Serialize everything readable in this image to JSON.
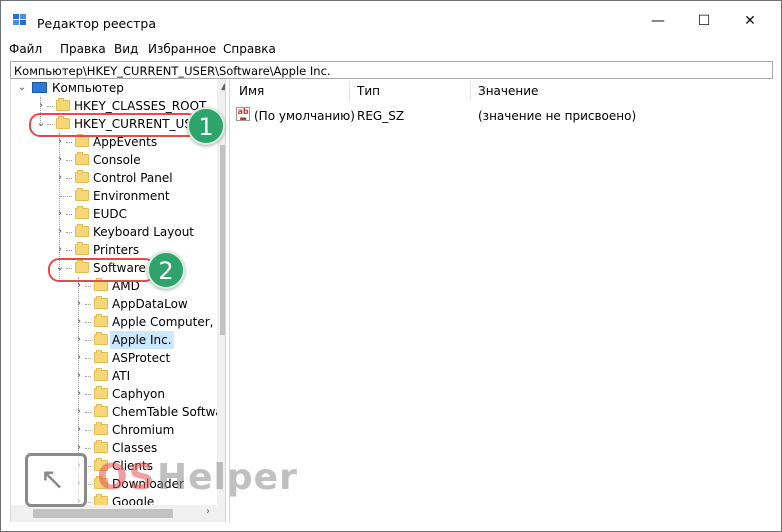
{
  "window": {
    "title": "Редактор реестра"
  },
  "title_buttons": {
    "minimize": "—",
    "maximize": "☐",
    "close": "✕"
  },
  "menu": [
    "Файл",
    "Правка",
    "Вид",
    "Избранное",
    "Справка"
  ],
  "address": "Компьютер\\HKEY_CURRENT_USER\\Software\\Apple Inc.",
  "tree": {
    "root": "Компьютер",
    "hives": [
      "HKEY_CLASSES_ROOT",
      "HKEY_CURRENT_USER"
    ],
    "hkcu_children": [
      "AppEvents",
      "Console",
      "Control Panel",
      "Environment",
      "EUDC",
      "Keyboard Layout",
      "Printers",
      "Software"
    ],
    "software_children": [
      "AMD",
      "AppDataLow",
      "Apple Computer,",
      "Apple Inc.",
      "ASProtect",
      "ATI",
      "Caphyon",
      "ChemTable Softwa",
      "Chromium",
      "Classes",
      "Clients",
      "Downloader",
      "Google"
    ],
    "selected": "Apple Inc."
  },
  "list": {
    "columns": [
      "Имя",
      "Тип",
      "Значение"
    ],
    "rows": [
      {
        "name": "(По умолчанию)",
        "type": "REG_SZ",
        "value": "(значение не присвоено)"
      }
    ]
  },
  "annotations": {
    "badge_1": "1",
    "badge_2": "2",
    "highlight_color": "#e24c4c",
    "badge_color": "#2fa36c"
  },
  "watermark": {
    "part1": "OS",
    "part2": "Helper"
  },
  "icons": {
    "app": "registry-editor-icon",
    "root": "computer-icon",
    "folder": "folder-icon",
    "value": "string-value-icon"
  }
}
